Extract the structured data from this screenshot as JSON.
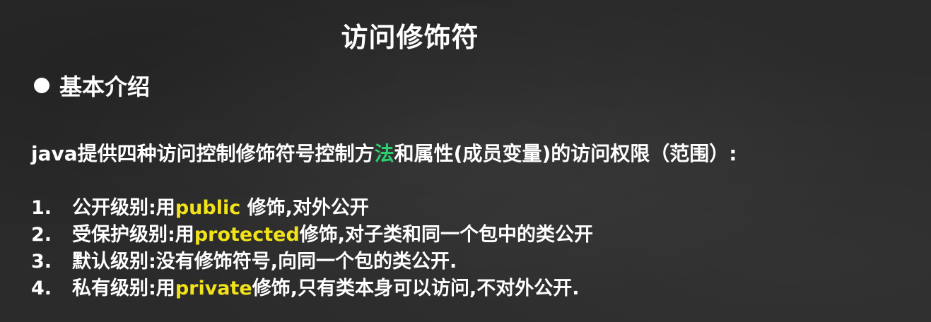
{
  "slide": {
    "title": "访问修饰符",
    "section_title": "基本介绍",
    "intro": {
      "before": "java提供四种访问控制修饰符号控制方",
      "highlight": "法",
      "after": "和属性(成员变量)的访问权限（范围）:"
    },
    "items": [
      {
        "num": "1.",
        "prefix": "公开级别:用",
        "keyword": "public",
        "suffix": " 修饰,对外公开"
      },
      {
        "num": "2.",
        "prefix": "受保护级别:用",
        "keyword": "protected",
        "suffix": "修饰,对子类和同一个包中的类公开"
      },
      {
        "num": "3.",
        "prefix": "默认级别:没有修饰符号,向同一个包的类公开.",
        "keyword": "",
        "suffix": ""
      },
      {
        "num": "4.",
        "prefix": "私有级别:用",
        "keyword": "private",
        "suffix": "修饰,只有类本身可以访问,不对外公开."
      }
    ]
  },
  "colors": {
    "background": "#2b2b2b",
    "text": "#ffffff",
    "keyword": "#f1e21a",
    "highlight": "#2ecc71"
  }
}
